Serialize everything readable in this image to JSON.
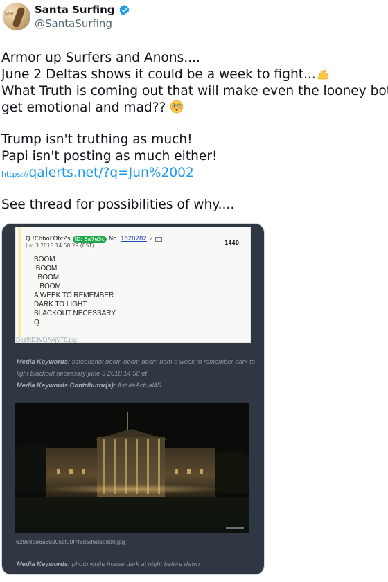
{
  "author": {
    "display_name": "Santa Surfing",
    "handle": "@SantaSurfing",
    "avatar_text": "SANT",
    "verified_color": "#1d9bf0"
  },
  "tweet": {
    "line1": "Armor up Surfers and Anons....",
    "line2": "June 2 Deltas shows it could be a week to fight...",
    "line3": "What Truth is coming out that will make even the looney bots",
    "line4": "get emotional and mad??",
    "line5": "Trump isn't truthing as much!",
    "line6": "Papi isn't posting as much either!",
    "link_prefix": "https://",
    "link_main": "qalerts.net/?q=Jun%2002",
    "line7": "See thread for possibilities of why....",
    "emoji_flex": "flexed-biceps",
    "emoji_flushed": "flushed-face"
  },
  "media": {
    "q_post": {
      "name": "Q !CbboFOtcZs",
      "id_badge": "ID: 5a7e3c",
      "no_label": "No.",
      "no_value": "1620282",
      "date": "Jun 3 2018 14:58:29 (EST)",
      "count": "1440",
      "lines": [
        "BOOM.",
        " BOOM.",
        "  BOOM.",
        "   BOOM.",
        "A WEEK TO REMEMBER.",
        "DARK TO LIGHT.",
        "BLACKOUT NECESSARY.",
        "Q"
      ]
    },
    "file1": "Dez9ID3VQAAjVT9.jpg",
    "kw1_label": "Media Keywords:",
    "kw1_text": "screenshot boom boom boom bom a week to remember dark to light blackout necessary june 3 2018 14 58 et",
    "contrib_label": "Media Keywords Contributor(s):",
    "contrib_text": "AstuteActual45",
    "file2": "62988de6a69205cf00f7f8d5d6ded8d0.jpg",
    "kw2_label": "Media Keywords:",
    "kw2_text": "photo white house dark at night before dawn"
  }
}
